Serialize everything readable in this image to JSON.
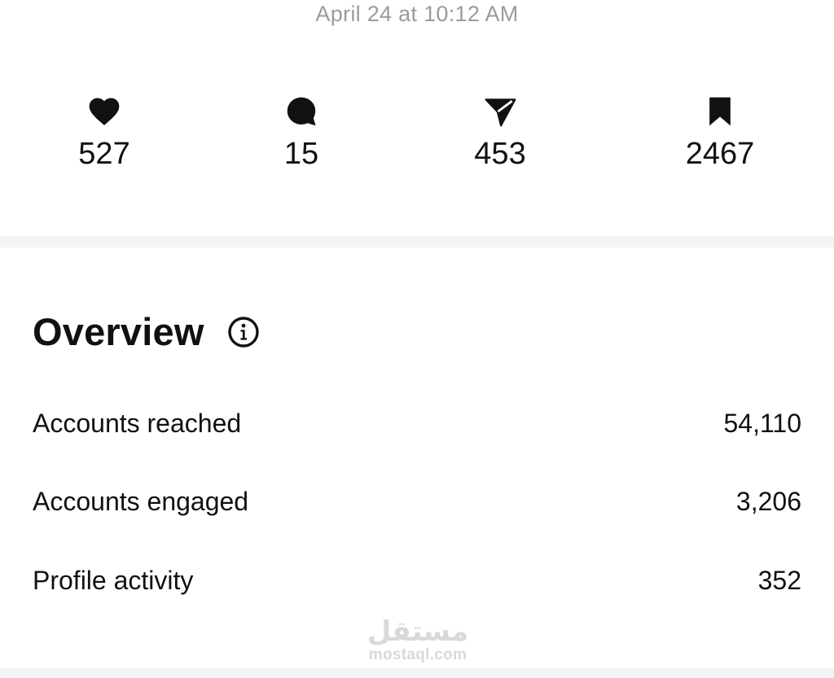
{
  "post": {
    "timestamp": "April 24 at 10:12 AM"
  },
  "stats": [
    {
      "icon": "heart-icon",
      "value": "527"
    },
    {
      "icon": "comment-icon",
      "value": "15"
    },
    {
      "icon": "share-icon",
      "value": "453"
    },
    {
      "icon": "bookmark-icon",
      "value": "2467"
    }
  ],
  "overview": {
    "title": "Overview",
    "info_icon": "info-icon",
    "metrics": [
      {
        "label": "Accounts reached",
        "value": "54,110"
      },
      {
        "label": "Accounts engaged",
        "value": "3,206"
      },
      {
        "label": "Profile activity",
        "value": "352"
      }
    ]
  },
  "watermark": {
    "arabic": "مستقل",
    "latin": "mostaql.com"
  },
  "colors": {
    "text": "#111111",
    "muted": "#9b9b9b",
    "divider": "#f4f4f4",
    "watermark": "#d9d9d9"
  }
}
